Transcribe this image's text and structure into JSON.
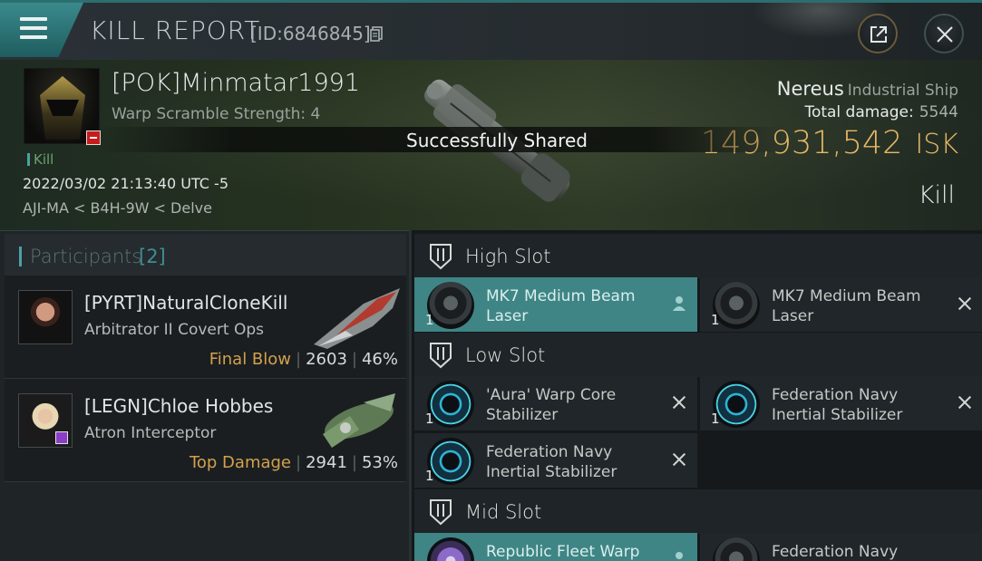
{
  "window": {
    "title": "KILL REPORT",
    "report_id": "[ID:6846845]"
  },
  "victim": {
    "name": "[POK]Minmatar1991",
    "warp_scramble": "Warp Scramble Strength: 4",
    "status": "Kill",
    "datetime": "2022/03/02 21:13:40 UTC -5",
    "location": "AJI-MA < B4H-9W < Delve",
    "ship_name": "Nereus",
    "ship_class": "Industrial Ship",
    "damage_label": "Total damage:",
    "damage_value": "5544",
    "isk_value": "149,931,542",
    "isk_unit": "ISK",
    "result": "Kill"
  },
  "toast": {
    "message": "Successfully Shared"
  },
  "participants": {
    "title": "Participants",
    "count": "[2]",
    "rows": [
      {
        "name": "[PYRT]NaturalCloneKill",
        "ship": "Arbitrator II Covert Ops",
        "role": "Final Blow",
        "damage": "2603",
        "percent": "46%"
      },
      {
        "name": "[LEGN]Chloe Hobbes",
        "ship": "Atron Interceptor",
        "role": "Top Damage",
        "damage": "2941",
        "percent": "53%"
      }
    ]
  },
  "fitting": {
    "high_slot": {
      "title": "High Slot",
      "modules": [
        {
          "qty": "1",
          "name": "MK7 Medium Beam Laser",
          "icon": "laser-module-icon",
          "state": "dropped"
        },
        {
          "qty": "1",
          "name": "MK7 Medium Beam Laser",
          "icon": "laser-module-icon",
          "state": "destroyed"
        }
      ]
    },
    "low_slot": {
      "title": "Low Slot",
      "modules": [
        {
          "qty": "1",
          "name": "'Aura' Warp Core Stabilizer",
          "icon": "warp-core-stabilizer-icon",
          "state": "destroyed"
        },
        {
          "qty": "1",
          "name": "Federation Navy Inertial Stabilizer",
          "icon": "inertial-stabilizer-icon",
          "state": "destroyed"
        },
        {
          "qty": "1",
          "name": "Federation Navy Inertial Stabilizer",
          "icon": "inertial-stabilizer-icon",
          "state": "destroyed"
        }
      ]
    },
    "mid_slot": {
      "title": "Mid Slot",
      "modules": [
        {
          "qty": "",
          "name": "Republic Fleet Warp",
          "icon": "warp-disruptor-icon",
          "state": "dropped"
        },
        {
          "qty": "",
          "name": "Federation Navy",
          "icon": "module-icon",
          "state": "destroyed"
        }
      ]
    }
  },
  "colors": {
    "accent_teal": "#3f8585",
    "isk_gold": "#e6b865",
    "role_gold": "#d3a14c"
  }
}
